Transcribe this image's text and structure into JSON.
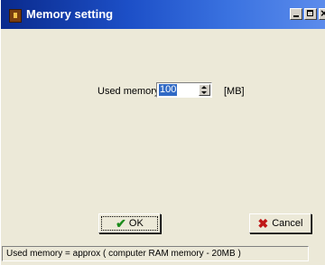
{
  "window": {
    "title": "Memory setting"
  },
  "form": {
    "used_memory_label": "Used memory",
    "used_memory_value": "100",
    "unit_label": "[MB]"
  },
  "buttons": {
    "ok_label": "OK",
    "cancel_label": "Cancel"
  },
  "status": {
    "text": "Used memory = approx ( computer RAM memory - 20MB )"
  },
  "icons": {
    "app": "app-icon",
    "ok": "check-icon",
    "cancel": "x-icon"
  },
  "colors": {
    "titlebar_start": "#0a2a8c",
    "titlebar_end": "#5c8cec",
    "selection": "#316ac5",
    "ok_icon": "#1c8c1c",
    "cancel_icon": "#c01818"
  }
}
